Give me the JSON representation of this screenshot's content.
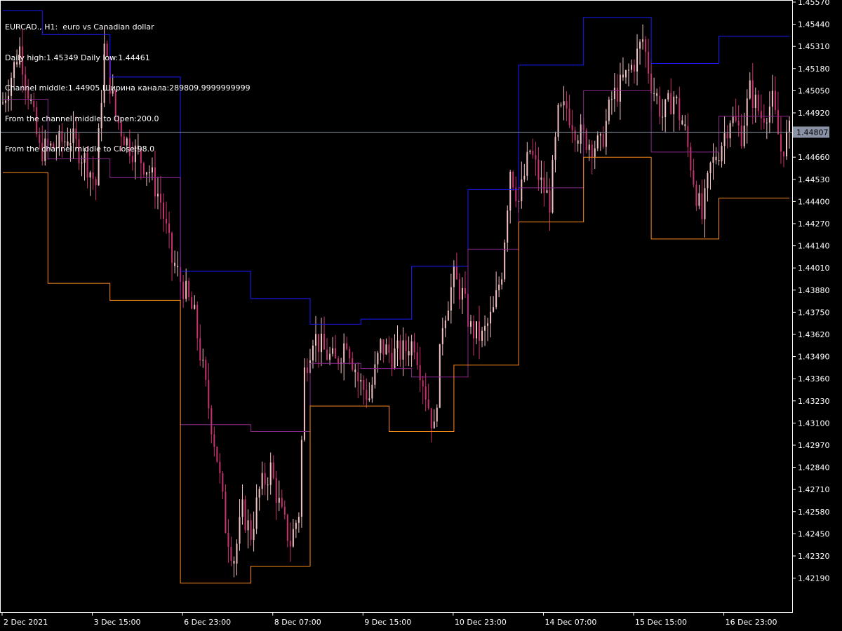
{
  "window": {
    "symbol_line": "EURCAD., H1:  euro vs Canadian dollar"
  },
  "info_lines": [
    "Daily high:1.45349 Daily low:1.44461",
    "Channel middle:1.44905 Ширина канала:289809.9999999999",
    "From the channel middle to Open:200.0",
    "From the channel middle to Close:98.0"
  ],
  "current_price": "1.44807",
  "colors": {
    "background": "#000000",
    "frame": "#ffffff",
    "bull_candle": "#3cb371",
    "bear_candle": "#c7336e",
    "doji_candle": "#f4c2c2",
    "channel_upper": "#1a1aff",
    "channel_middle": "#8b2a8b",
    "channel_lower": "#ff8c1a",
    "current_price_line": "#8a93a6",
    "price_tag_bg": "#8a93a6"
  },
  "chart_data": {
    "type": "candlestick",
    "price_axis": {
      "ticks": [
        "1.45570",
        "1.45440",
        "1.45310",
        "1.45180",
        "1.45050",
        "1.44920",
        "1.44790",
        "1.44660",
        "1.44530",
        "1.44400",
        "1.44270",
        "1.44140",
        "1.44010",
        "1.43880",
        "1.43750",
        "1.43620",
        "1.43490",
        "1.43360",
        "1.43230",
        "1.43100",
        "1.42970",
        "1.42840",
        "1.42710",
        "1.42580",
        "1.42450",
        "1.42320",
        "1.42190"
      ],
      "ylim": [
        1.4211,
        1.4557
      ]
    },
    "time_axis": {
      "ticks": [
        "2 Dec 2021",
        "3 Dec 15:00",
        "6 Dec 23:00",
        "8 Dec 07:00",
        "9 Dec 15:00",
        "10 Dec 23:00",
        "14 Dec 07:00",
        "15 Dec 15:00",
        "16 Dec 23:00"
      ]
    },
    "channel_upper": [
      [
        0,
        1.4552
      ],
      [
        14,
        1.4552
      ],
      [
        14,
        1.4538
      ],
      [
        38,
        1.4538
      ],
      [
        38,
        1.4513
      ],
      [
        63,
        1.4513
      ],
      [
        63,
        1.4399
      ],
      [
        88,
        1.4399
      ],
      [
        88,
        1.4383
      ],
      [
        109,
        1.4383
      ],
      [
        109,
        1.4368
      ],
      [
        127,
        1.4368
      ],
      [
        127,
        1.4371
      ],
      [
        145,
        1.4371
      ],
      [
        145,
        1.4402
      ],
      [
        165,
        1.4402
      ],
      [
        165,
        1.4447
      ],
      [
        183,
        1.4447
      ],
      [
        183,
        1.452
      ],
      [
        206,
        1.452
      ],
      [
        206,
        1.4548
      ],
      [
        230,
        1.4548
      ],
      [
        230,
        1.4521
      ],
      [
        254,
        1.4521
      ],
      [
        254,
        1.4537
      ],
      [
        279,
        1.4537
      ]
    ],
    "channel_middle": [
      [
        0,
        1.45
      ],
      [
        16,
        1.45
      ],
      [
        16,
        1.4465
      ],
      [
        38,
        1.4465
      ],
      [
        38,
        1.4454
      ],
      [
        63,
        1.4454
      ],
      [
        63,
        1.4309
      ],
      [
        88,
        1.4309
      ],
      [
        88,
        1.4305
      ],
      [
        109,
        1.4305
      ],
      [
        109,
        1.4345
      ],
      [
        127,
        1.4345
      ],
      [
        127,
        1.4342
      ],
      [
        145,
        1.4342
      ],
      [
        145,
        1.4337
      ],
      [
        165,
        1.4337
      ],
      [
        165,
        1.4412
      ],
      [
        183,
        1.4412
      ],
      [
        183,
        1.4448
      ],
      [
        206,
        1.4448
      ],
      [
        206,
        1.4505
      ],
      [
        230,
        1.4505
      ],
      [
        230,
        1.4469
      ],
      [
        254,
        1.4469
      ],
      [
        254,
        1.449
      ],
      [
        279,
        1.449
      ]
    ],
    "channel_lower": [
      [
        0,
        1.4457
      ],
      [
        16,
        1.4457
      ],
      [
        16,
        1.4392
      ],
      [
        38,
        1.4392
      ],
      [
        38,
        1.4382
      ],
      [
        63,
        1.4382
      ],
      [
        63,
        1.4216
      ],
      [
        88,
        1.4216
      ],
      [
        88,
        1.4226
      ],
      [
        109,
        1.4226
      ],
      [
        109,
        1.432
      ],
      [
        137,
        1.432
      ],
      [
        137,
        1.4305
      ],
      [
        160,
        1.4305
      ],
      [
        160,
        1.4344
      ],
      [
        183,
        1.4344
      ],
      [
        183,
        1.4428
      ],
      [
        206,
        1.4428
      ],
      [
        206,
        1.4466
      ],
      [
        230,
        1.4466
      ],
      [
        230,
        1.4418
      ],
      [
        254,
        1.4418
      ],
      [
        254,
        1.4442
      ],
      [
        279,
        1.4442
      ]
    ],
    "close_anchors": [
      [
        0,
        1.4498
      ],
      [
        6,
        1.453
      ],
      [
        9,
        1.4505
      ],
      [
        13,
        1.447
      ],
      [
        18,
        1.4472
      ],
      [
        24,
        1.4478
      ],
      [
        30,
        1.4462
      ],
      [
        33,
        1.445
      ],
      [
        36,
        1.453
      ],
      [
        40,
        1.449
      ],
      [
        44,
        1.4475
      ],
      [
        48,
        1.4467
      ],
      [
        52,
        1.4458
      ],
      [
        56,
        1.444
      ],
      [
        60,
        1.4405
      ],
      [
        64,
        1.439
      ],
      [
        68,
        1.4372
      ],
      [
        72,
        1.433
      ],
      [
        76,
        1.429
      ],
      [
        79,
        1.425
      ],
      [
        82,
        1.423
      ],
      [
        85,
        1.4258
      ],
      [
        88,
        1.4245
      ],
      [
        91,
        1.427
      ],
      [
        95,
        1.4283
      ],
      [
        99,
        1.4255
      ],
      [
        102,
        1.424
      ],
      [
        105,
        1.4258
      ],
      [
        107,
        1.434
      ],
      [
        110,
        1.4362
      ],
      [
        114,
        1.4352
      ],
      [
        118,
        1.4345
      ],
      [
        122,
        1.436
      ],
      [
        126,
        1.4335
      ],
      [
        130,
        1.4325
      ],
      [
        134,
        1.4355
      ],
      [
        138,
        1.435
      ],
      [
        142,
        1.4352
      ],
      [
        146,
        1.4358
      ],
      [
        150,
        1.4328
      ],
      [
        153,
        1.4305
      ],
      [
        156,
        1.437
      ],
      [
        160,
        1.4395
      ],
      [
        163,
        1.4385
      ],
      [
        166,
        1.4365
      ],
      [
        170,
        1.436
      ],
      [
        174,
        1.4375
      ],
      [
        177,
        1.44
      ],
      [
        180,
        1.446
      ],
      [
        183,
        1.444
      ],
      [
        187,
        1.447
      ],
      [
        191,
        1.445
      ],
      [
        194,
        1.444
      ],
      [
        197,
        1.449
      ],
      [
        200,
        1.4495
      ],
      [
        204,
        1.448
      ],
      [
        208,
        1.4475
      ],
      [
        212,
        1.4472
      ],
      [
        216,
        1.45
      ],
      [
        220,
        1.451
      ],
      [
        224,
        1.4522
      ],
      [
        227,
        1.4535
      ],
      [
        230,
        1.451
      ],
      [
        234,
        1.449
      ],
      [
        238,
        1.4502
      ],
      [
        242,
        1.448
      ],
      [
        246,
        1.4445
      ],
      [
        248,
        1.443
      ],
      [
        251,
        1.446
      ],
      [
        254,
        1.447
      ],
      [
        258,
        1.449
      ],
      [
        262,
        1.448
      ],
      [
        265,
        1.4505
      ],
      [
        269,
        1.449
      ],
      [
        273,
        1.4498
      ],
      [
        276,
        1.447
      ],
      [
        279,
        1.448
      ]
    ]
  }
}
